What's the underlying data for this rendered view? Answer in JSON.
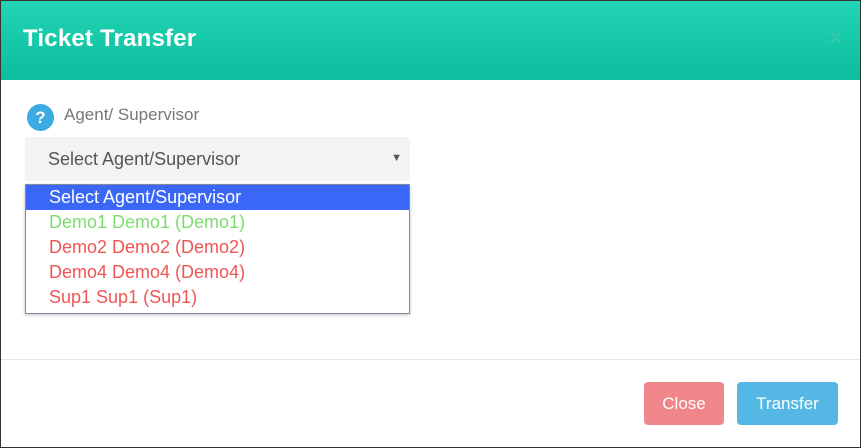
{
  "modal": {
    "title": "Ticket Transfer",
    "close_icon": "close-icon"
  },
  "field": {
    "help_icon": "question-circle-icon",
    "help_glyph": "?",
    "label": "Agent/ Supervisor",
    "selected_value": "Select Agent/Supervisor",
    "arrow_glyph": "▼"
  },
  "dropdown": {
    "options": [
      {
        "label": "Select Agent/Supervisor",
        "color": "#ffffff",
        "selected": true
      },
      {
        "label": "Demo1 Demo1 (Demo1)",
        "color": "#7ddc6f",
        "selected": false
      },
      {
        "label": "Demo2 Demo2 (Demo2)",
        "color": "#ef5552",
        "selected": false
      },
      {
        "label": "Demo4 Demo4 (Demo4)",
        "color": "#ef5552",
        "selected": false
      },
      {
        "label": "Sup1 Sup1 (Sup1)",
        "color": "#ef5552",
        "selected": false
      }
    ]
  },
  "footer": {
    "close_label": "Close",
    "transfer_label": "Transfer"
  },
  "colors": {
    "header": "#12c4a6",
    "selected_option": "#3b67f6",
    "close_button": "#f0868c",
    "transfer_button": "#55b7e4"
  }
}
